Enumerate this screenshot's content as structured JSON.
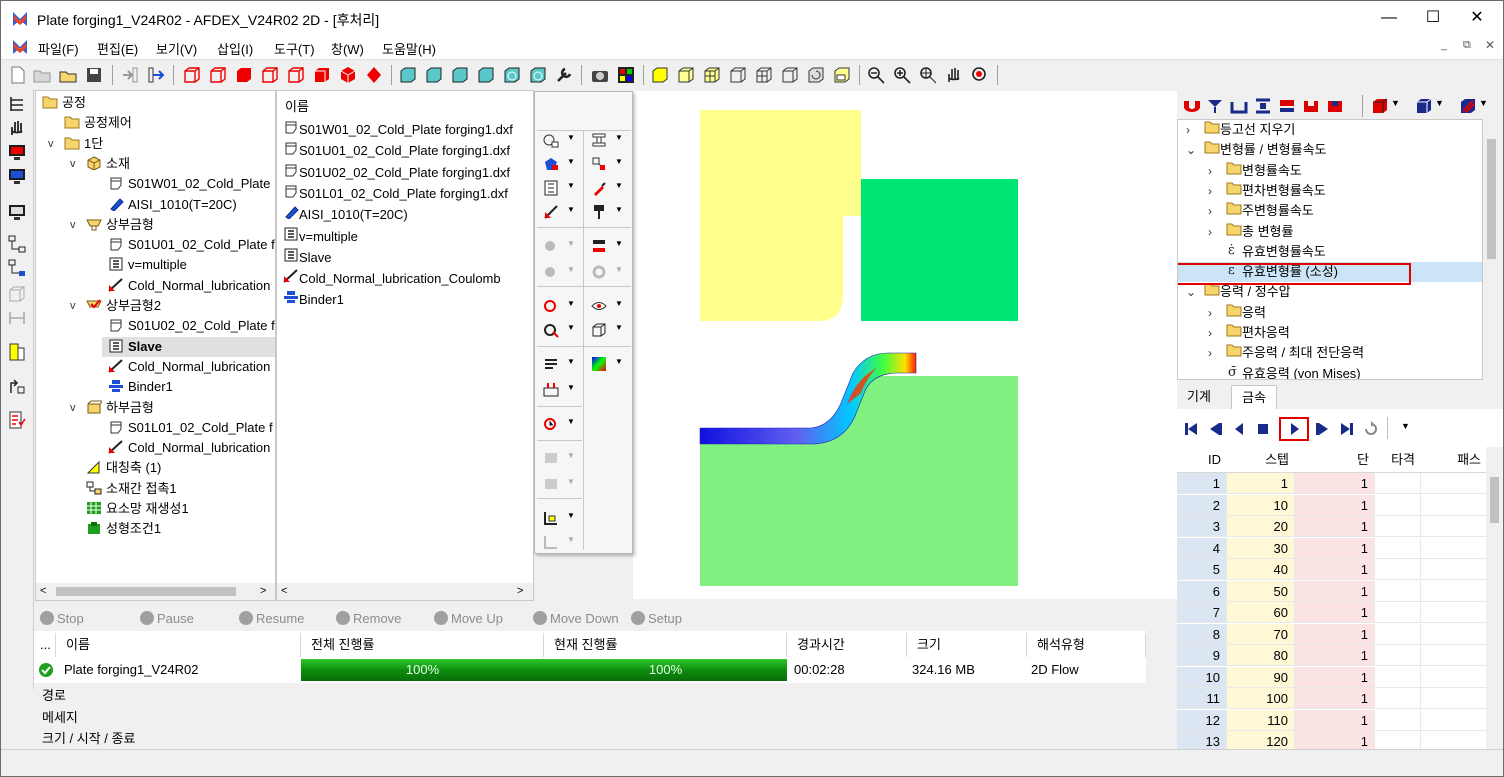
{
  "window": {
    "title": "Plate forging1_V24R02 - AFDEX_V24R02 2D - [후처리]",
    "minimize": "—",
    "maximize": "☐",
    "close": "✕"
  },
  "menu": [
    "파일(F)",
    "편집(E)",
    "보기(V)",
    "삽입(I)",
    "도구(T)",
    "창(W)",
    "도움말(H)"
  ],
  "process_tree": {
    "items": [
      {
        "label": "공정",
        "indent": 0,
        "icon": "folder"
      },
      {
        "label": "공정제어",
        "indent": 1,
        "icon": "folder"
      },
      {
        "label": "1단",
        "indent": 1,
        "icon": "folder",
        "chev": "v"
      },
      {
        "label": "소재",
        "indent": 2,
        "icon": "material",
        "chev": "v"
      },
      {
        "label": "S01W01_02_Cold_Plate",
        "indent": 3,
        "icon": "part"
      },
      {
        "label": "AISI_1010(T=20C)",
        "indent": 3,
        "icon": "alloy"
      },
      {
        "label": "상부금형",
        "indent": 2,
        "icon": "die",
        "chev": "v"
      },
      {
        "label": "S01U01_02_Cold_Plate f",
        "indent": 3,
        "icon": "part"
      },
      {
        "label": "v=multiple",
        "indent": 3,
        "icon": "press"
      },
      {
        "label": "Cold_Normal_lubrication",
        "indent": 3,
        "icon": "lube"
      },
      {
        "label": "상부금형2",
        "indent": 2,
        "icon": "die2",
        "chev": "v"
      },
      {
        "label": "S01U02_02_Cold_Plate f",
        "indent": 3,
        "icon": "part"
      },
      {
        "label": "Slave",
        "indent": 3,
        "icon": "press",
        "selected": true
      },
      {
        "label": "Cold_Normal_lubrication",
        "indent": 3,
        "icon": "lube"
      },
      {
        "label": "Binder1",
        "indent": 3,
        "icon": "binder"
      },
      {
        "label": "하부금형",
        "indent": 2,
        "icon": "die3",
        "chev": "v"
      },
      {
        "label": "S01L01_02_Cold_Plate f",
        "indent": 3,
        "icon": "part"
      },
      {
        "label": "Cold_Normal_lubrication",
        "indent": 3,
        "icon": "lube"
      },
      {
        "label": "대칭축 (1)",
        "indent": 2,
        "icon": "sym"
      },
      {
        "label": "소재간 접촉1",
        "indent": 2,
        "icon": "contact"
      },
      {
        "label": "요소망 재생성1",
        "indent": 2,
        "icon": "mesh"
      },
      {
        "label": "성형조건1",
        "indent": 2,
        "icon": "cond"
      }
    ]
  },
  "file_list": {
    "header": "이름",
    "items": [
      {
        "label": "S01W01_02_Cold_Plate forging1.dxf",
        "icon": "part"
      },
      {
        "label": "S01U01_02_Cold_Plate forging1.dxf",
        "icon": "part"
      },
      {
        "label": "S01U02_02_Cold_Plate forging1.dxf",
        "icon": "part"
      },
      {
        "label": "S01L01_02_Cold_Plate forging1.dxf",
        "icon": "part"
      },
      {
        "label": "AISI_1010(T=20C)",
        "icon": "alloy"
      },
      {
        "label": "v=multiple",
        "icon": "press"
      },
      {
        "label": "Slave",
        "icon": "press"
      },
      {
        "label": "Cold_Normal_lubrication_Coulomb",
        "icon": "lube"
      },
      {
        "label": "Binder1",
        "icon": "binder"
      }
    ]
  },
  "results_tree": {
    "items": [
      {
        "label": "등고선 지우기",
        "indent": 1,
        "icon": "folder",
        "chev": ">"
      },
      {
        "label": "변형률 / 변형률속도",
        "indent": 1,
        "icon": "folder",
        "chev": "v"
      },
      {
        "label": "변형률속도",
        "indent": 2,
        "icon": "folder",
        "chev": ">"
      },
      {
        "label": "편차변형률속도",
        "indent": 2,
        "icon": "folder",
        "chev": ">"
      },
      {
        "label": "주변형률속도",
        "indent": 2,
        "icon": "folder",
        "chev": ">"
      },
      {
        "label": "총 변형률",
        "indent": 2,
        "icon": "folder",
        "chev": ">"
      },
      {
        "label": "유효변형률속도",
        "indent": 2,
        "icon": "epsdot"
      },
      {
        "label": "유효변형률 (소성)",
        "indent": 2,
        "icon": "eps",
        "selected": true
      },
      {
        "label": "응력 / 정수압",
        "indent": 1,
        "icon": "folder",
        "chev": "v"
      },
      {
        "label": "응력",
        "indent": 2,
        "icon": "folder",
        "chev": ">"
      },
      {
        "label": "편차응력",
        "indent": 2,
        "icon": "folder",
        "chev": ">"
      },
      {
        "label": "주응력 / 최대 전단응력",
        "indent": 2,
        "icon": "folder",
        "chev": ">"
      },
      {
        "label": "유효응력 (von Mises)",
        "indent": 2,
        "icon": "sigma"
      }
    ]
  },
  "tabs": {
    "machine": "기계",
    "metal": "금속"
  },
  "step_table": {
    "headers": {
      "id": "ID",
      "step": "스텝",
      "stage": "단",
      "strike": "타격",
      "pass": "패스"
    },
    "rows": [
      {
        "id": "1",
        "step": "1",
        "stage": "1"
      },
      {
        "id": "2",
        "step": "10",
        "stage": "1"
      },
      {
        "id": "3",
        "step": "20",
        "stage": "1"
      },
      {
        "id": "4",
        "step": "30",
        "stage": "1"
      },
      {
        "id": "5",
        "step": "40",
        "stage": "1"
      },
      {
        "id": "6",
        "step": "50",
        "stage": "1"
      },
      {
        "id": "7",
        "step": "60",
        "stage": "1"
      },
      {
        "id": "8",
        "step": "70",
        "stage": "1"
      },
      {
        "id": "9",
        "step": "80",
        "stage": "1"
      },
      {
        "id": "10",
        "step": "90",
        "stage": "1"
      },
      {
        "id": "11",
        "step": "100",
        "stage": "1"
      },
      {
        "id": "12",
        "step": "110",
        "stage": "1"
      },
      {
        "id": "13",
        "step": "120",
        "stage": "1"
      }
    ]
  },
  "job_controls": {
    "stop": "Stop",
    "pause": "Pause",
    "resume": "Resume",
    "remove": "Remove",
    "move_up": "Move Up",
    "move_down": "Move Down",
    "setup": "Setup"
  },
  "job_table": {
    "headers": {
      "dots": "...",
      "name": "이름",
      "total": "전체 진행률",
      "current": "현재 진행률",
      "elapsed": "경과시간",
      "size": "크기",
      "type": "해석유형"
    },
    "row": {
      "name": "Plate forging1_V24R02",
      "total": "100%",
      "current": "100%",
      "total_fraction": 1.0,
      "current_fraction": 1.0,
      "elapsed": "00:02:28",
      "size": "324.16 MB",
      "type": "2D Flow"
    }
  },
  "info": {
    "path": "경로",
    "message": "메세지",
    "size_start_end": "크기 / 시작 / 종료"
  },
  "colors": {
    "selection": "#cce4f7",
    "highlight_box": "#e00000",
    "upper_die": "#ffff8c",
    "punch": "#00e676",
    "lower_die": "#80f080",
    "progress": "#0c8a0c"
  }
}
